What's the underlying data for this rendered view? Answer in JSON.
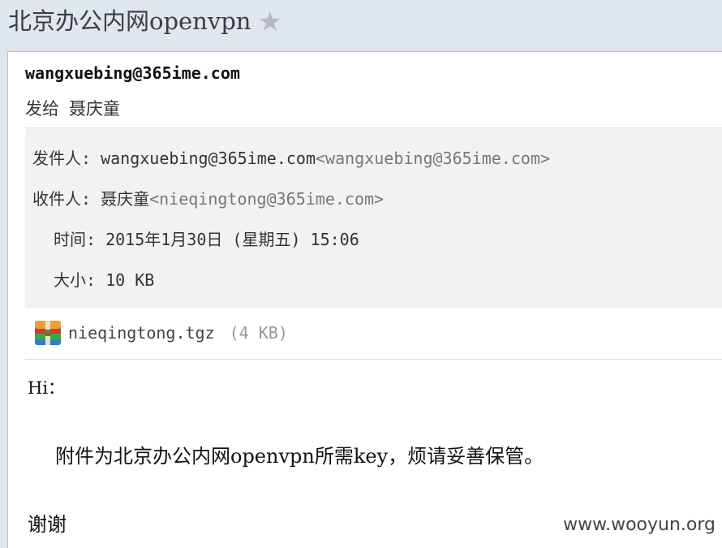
{
  "header": {
    "subject": "北京办公内网openvpn",
    "star_icon": "star-icon"
  },
  "mail": {
    "sender_display": "wangxuebing@365ime.com",
    "sendto_label": "发给",
    "sendto_name": "聂庆童",
    "details": {
      "from_label": "发件人",
      "from_name": "wangxuebing@365ime.com",
      "from_addr": "<wangxuebing@365ime.com>",
      "to_label": "收件人",
      "to_name": "聂庆童",
      "to_addr": "<nieqingtong@365ime.com>",
      "time_label": "时间",
      "time_value": "2015年1月30日 (星期五) 15:06",
      "size_label": "大小",
      "size_value": "10 KB"
    },
    "attachment": {
      "icon": "archive-icon",
      "filename": "nieqingtong.tgz",
      "size": "(4 KB)"
    },
    "body": {
      "greeting": "Hi：",
      "line": "附件为北京办公内网openvpn所需key，烦请妥善保管。",
      "thanks": "谢谢"
    }
  },
  "watermark": "www.wooyun.org"
}
